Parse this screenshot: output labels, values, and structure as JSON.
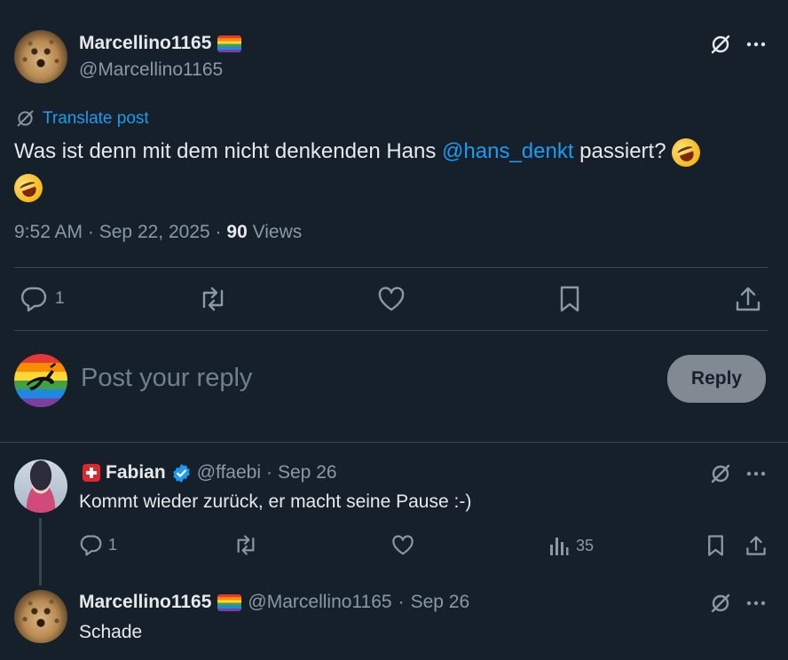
{
  "main_post": {
    "author_name": "Marcellino1165",
    "author_handle": "@Marcellino1165",
    "translate_label": "Translate post",
    "text_before": "Was ist denn mit dem nicht denkenden Hans ",
    "mention": "@hans_denkt",
    "text_after": " passiert?",
    "time": "9:52 AM",
    "date": "Sep 22, 2025",
    "views_count": "90",
    "views_label": "Views",
    "reply_count": "1"
  },
  "composer": {
    "placeholder": "Post your reply",
    "button_label": "Reply"
  },
  "replies": [
    {
      "author_name": "Fabian",
      "author_handle": "@ffaebi",
      "date": "Sep 26",
      "text": "Kommt wieder zurück, er macht seine Pause :-)",
      "reply_count": "1",
      "views_count": "35"
    },
    {
      "author_name": "Marcellino1165",
      "author_handle": "@Marcellino1165",
      "date": "Sep 26",
      "text": "Schade"
    }
  ],
  "colors": {
    "background": "#15202b",
    "text": "#e7e9ea",
    "muted": "#8b98a5",
    "accent": "#1d9bf0",
    "divider": "#38444d",
    "verified": "#1d9bf0"
  },
  "icons": [
    "grok-icon",
    "more-icon",
    "translate-icon",
    "reply-icon",
    "repost-icon",
    "like-icon",
    "bookmark-icon",
    "share-icon",
    "views-icon",
    "verified-badge-icon",
    "rainbow-flag-icon",
    "swiss-flag-icon",
    "rofl-emoji"
  ]
}
